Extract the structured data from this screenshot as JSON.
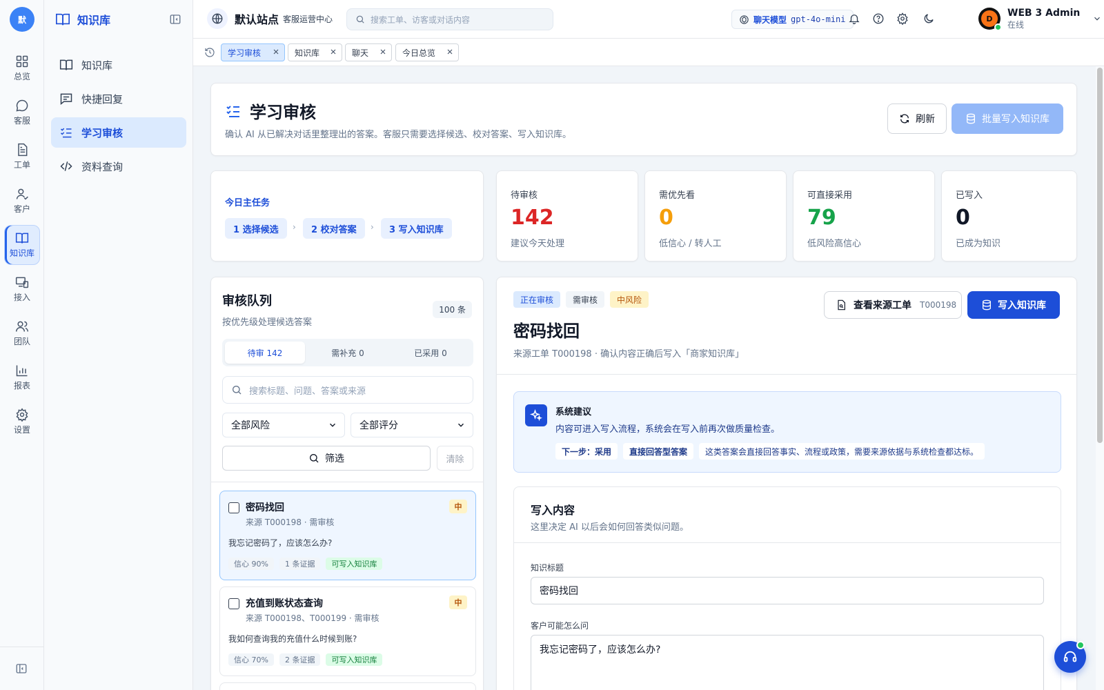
{
  "rail": {
    "logo": "默",
    "items": [
      {
        "label": "总览",
        "icon": "dashboard-icon"
      },
      {
        "label": "客服",
        "icon": "chat-icon"
      },
      {
        "label": "工单",
        "icon": "ticket-icon"
      },
      {
        "label": "客户",
        "icon": "customer-icon"
      },
      {
        "label": "知识库",
        "icon": "book-icon",
        "active": true
      },
      {
        "label": "接入",
        "icon": "devices-icon"
      },
      {
        "label": "团队",
        "icon": "team-icon"
      },
      {
        "label": "报表",
        "icon": "chart-icon"
      },
      {
        "label": "设置",
        "icon": "gear-icon"
      }
    ]
  },
  "sidebar": {
    "title": "知识库",
    "items": [
      {
        "label": "知识库"
      },
      {
        "label": "快捷回复"
      },
      {
        "label": "学习审核",
        "active": true
      },
      {
        "label": "资料查询"
      }
    ]
  },
  "topbar": {
    "site_name": "默认站点",
    "site_sub": "客服运营中心",
    "search_placeholder": "搜索工单、访客或对话内容",
    "model_label": "聊天模型",
    "model_name": "gpt-4o-mini",
    "user_name": "WEB 3 Admin",
    "user_status": "在线",
    "avatar_letter": "D"
  },
  "tabs": [
    {
      "label": "学习审核",
      "active": true
    },
    {
      "label": "知识库"
    },
    {
      "label": "聊天"
    },
    {
      "label": "今日总览"
    }
  ],
  "header": {
    "title": "学习审核",
    "desc": "确认 AI 从已解决对话里整理出的答案。客服只需要选择候选、校对答案、写入知识库。",
    "refresh": "刷新",
    "batch": "批量写入知识库"
  },
  "tasks": {
    "title": "今日主任务",
    "steps": [
      "1 选择候选",
      "2 校对答案",
      "3 写入知识库"
    ]
  },
  "stats": [
    {
      "label": "待审核",
      "value": "142",
      "sub": "建议今天处理",
      "color": "#dc2626"
    },
    {
      "label": "需优先看",
      "value": "0",
      "sub": "低信心 / 转人工",
      "color": "#f59e0b"
    },
    {
      "label": "可直接采用",
      "value": "79",
      "sub": "低风险高信心",
      "color": "#16a34a"
    },
    {
      "label": "已写入",
      "value": "0",
      "sub": "已成为知识",
      "color": "#111827"
    }
  ],
  "queue": {
    "title": "审核队列",
    "subtitle": "按优先级处理候选答案",
    "count": "100 条",
    "seg": [
      "待审 142",
      "需补充 0",
      "已采用 0"
    ],
    "search_placeholder": "搜索标题、问题、答案或来源",
    "risk_select": "全部风险",
    "score_select": "全部评分",
    "filter": "筛选",
    "clear": "清除",
    "items": [
      {
        "title": "密码找回",
        "source": "来源 T000198 · 需审核",
        "risk": "中",
        "question": "我忘记密码了，应该怎么办?",
        "tags": [
          "信心 90%",
          "1 条证据",
          "可写入知识库"
        ]
      },
      {
        "title": "充值到账状态查询",
        "source": "来源 T000198、T000199 · 需审核",
        "risk": "中",
        "question": "我如何查询我的充值什么时候到账?",
        "tags": [
          "信心 70%",
          "2 条证据",
          "可写入知识库"
        ]
      }
    ]
  },
  "detail": {
    "badges": [
      "正在审核",
      "需审核",
      "中风险"
    ],
    "title": "密码找回",
    "sub": "来源工单 T000198 · 确认内容正确后写入「商家知识库」",
    "src_btn": "查看来源工单",
    "src_code": "T000198",
    "write_btn": "写入知识库",
    "suggest": {
      "title": "系统建议",
      "desc": "内容可进入写入流程，系统会在写入前再次做质量检查。",
      "chips": [
        "下一步：采用",
        "直接回答型答案",
        "这类答案会直接回答事实、流程或政策，需要来源依据与系统检查都达标。"
      ]
    },
    "form": {
      "title": "写入内容",
      "sub": "这里决定 AI 以后会如何回答类似问题。",
      "title_label": "知识标题",
      "title_value": "密码找回",
      "q_label": "客户可能怎么问",
      "q_value": "我忘记密码了，应该怎么办?"
    }
  }
}
